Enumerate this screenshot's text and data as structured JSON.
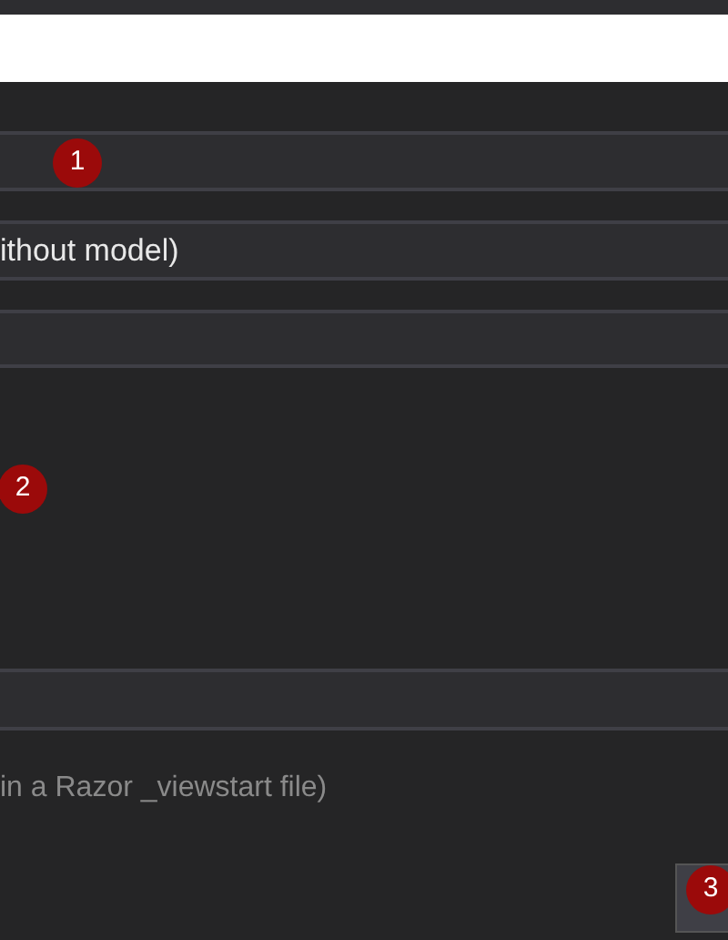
{
  "fields": [
    {
      "kind": "input"
    },
    {
      "kind": "dropdown",
      "value": "ithout model)"
    },
    {
      "kind": "dropdown"
    },
    {
      "kind": "list"
    },
    {
      "kind": "input"
    }
  ],
  "hint": "in a Razor _viewstart file)",
  "badges": [
    {
      "label": "1"
    },
    {
      "label": "2"
    },
    {
      "label": "3"
    }
  ]
}
